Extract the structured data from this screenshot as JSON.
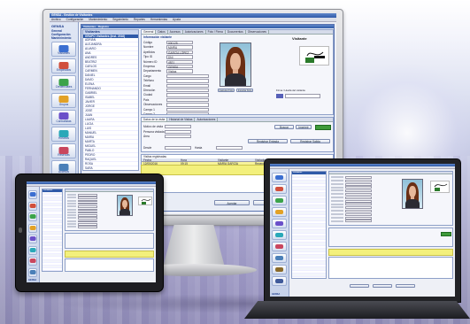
{
  "monitor_app": {
    "window_title": "GENSA - Gestión de Visitantes",
    "menu": [
      "Archivo",
      "Configuración",
      "Mantenimiento",
      "Seguimiento",
      "Reportes",
      "Herramientas",
      "Ayuda"
    ],
    "brand": "GENSA",
    "sidebar_captions": [
      "General",
      "Configuración",
      "Mantenimiento"
    ],
    "sidebar_items": [
      "Visitantes",
      "Empleados",
      "Credenciales",
      "Grupos",
      "Contratistas",
      "Horarios",
      "Reservas",
      "Accesos",
      "Reportes",
      "Sistema"
    ],
    "child_window_title": "Visitantes - Registro",
    "list_header": "Visitantes",
    "list_subheader": "GRUPO Visitantes (Inst. 2016)",
    "list_rows": [
      "ADRIÁN",
      "ALEJANDRA",
      "ÁLVARO",
      "ANA",
      "ANDRÉS",
      "BEATRIZ",
      "CARLOS",
      "CARMEN",
      "DANIEL",
      "DAVID",
      "ELENA",
      "FERNANDO",
      "GABRIEL",
      "ISABEL",
      "JAVIER",
      "JORGE",
      "JOSÉ",
      "JUAN",
      "LAURA",
      "LUCÍA",
      "LUIS",
      "MANUEL",
      "MARÍA",
      "MARTA",
      "MIGUEL",
      "PABLO",
      "PEDRO",
      "RAQUEL",
      "ROSA",
      "SARA"
    ],
    "tabs": [
      "General",
      "Datos",
      "Accesos",
      "Autorizaciones",
      "Foto / Firma",
      "Documentos",
      "Observaciones"
    ],
    "form_section": "Información visitante",
    "fields": [
      {
        "label": "Código",
        "value": "000125"
      },
      {
        "label": "Nombre",
        "value": "MARÍA"
      },
      {
        "label": "Apellidos",
        "value": "GARCÍA LÓPEZ"
      },
      {
        "label": "Tipo ID",
        "value": "DNI"
      },
      {
        "label": "Número ID",
        "value": "4521"
      },
      {
        "label": "Empresa",
        "value": "GENSA"
      },
      {
        "label": "Departamento",
        "value": "Visitas"
      },
      {
        "label": "Cargo",
        "value": ""
      },
      {
        "label": "Teléfono",
        "value": ""
      },
      {
        "label": "Email",
        "value": ""
      },
      {
        "label": "Dirección",
        "value": ""
      },
      {
        "label": "Ciudad",
        "value": ""
      },
      {
        "label": "País",
        "value": ""
      },
      {
        "label": "Observaciones",
        "value": ""
      },
      {
        "label": "Campo 1",
        "value": ""
      },
      {
        "label": "Campo 2",
        "value": ""
      }
    ],
    "photo_buttons": [
      "Capturar Foto",
      "Importar Foto"
    ],
    "right_panel_title": "Visitante",
    "signature_label": "Firma / Huella del visitante",
    "visit_tabs": [
      "Datos de la visita",
      "Historial de Visitas",
      "Autorizaciones"
    ],
    "visit_fields": [
      "Motivo de visita",
      "Persona visitada",
      "Área",
      "Desde",
      "Hasta"
    ],
    "visit_buttons": [
      "Buscar",
      "Imprimir",
      "Registrar Entrada",
      "Registrar Salida"
    ],
    "grid_caption": "Visitas registradas",
    "grid_headers": [
      "Fecha",
      "Hora",
      "Visitante",
      "Visitado",
      "Estado"
    ],
    "grid_selected": [
      "12/05/2016",
      "09:15",
      "MARÍA GARCÍA",
      "Recepción",
      "Activa"
    ],
    "bottom_buttons": [
      "Aceptar",
      "Cancelar",
      "Aplicar"
    ],
    "bottom_status": "Listo"
  },
  "tablet_app": {
    "brand": "GENSA",
    "list_header": "Visitantes"
  },
  "laptop_app": {
    "brand": "GENSA",
    "list_header": "Visitantes"
  },
  "colors": {
    "titlebar": "#2f5aa8",
    "highlight": "#f3f07c",
    "status_green": "#3f9a3a",
    "accent_blue": "#5660b8"
  }
}
